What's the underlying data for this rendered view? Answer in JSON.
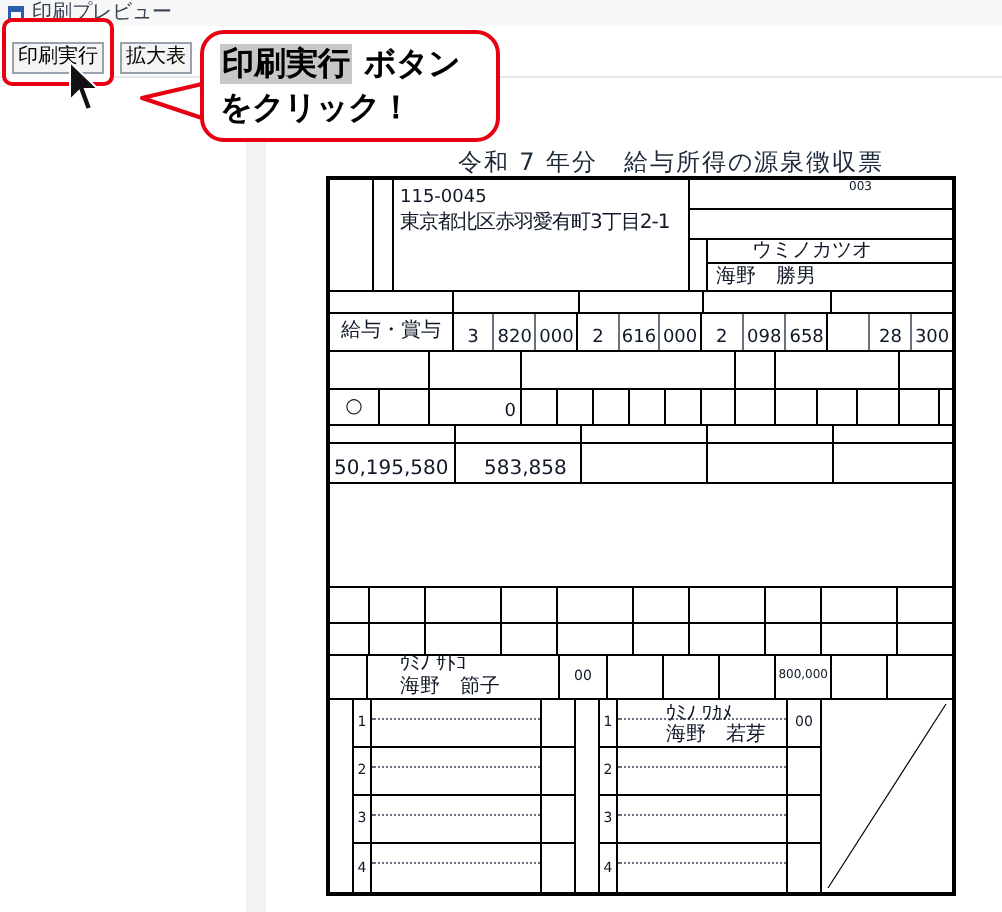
{
  "window": {
    "title": "印刷プレビュー"
  },
  "toolbar": {
    "buttons": [
      {
        "label": "印刷実行",
        "highlighted": true
      },
      {
        "label": "拡大表",
        "highlighted": false
      }
    ]
  },
  "callout": {
    "highlight": "印刷実行",
    "line_1": "ボタン",
    "line_2": "をクリック！"
  },
  "form": {
    "title": "令和 7 年分　給与所得の源泉徴収票",
    "postal_code": "115-0045",
    "address": "東京都北区赤羽愛有町3丁目2-1",
    "recipient_number": "003",
    "name_kana": "ウミノカツオ",
    "name": "海野　勝男",
    "type": "給与・賞与",
    "amounts": [
      [
        "3",
        "820",
        "000"
      ],
      [
        "2",
        "616",
        "000"
      ],
      [
        "2",
        "098",
        "658"
      ],
      [
        "28",
        "300"
      ]
    ],
    "spouse_mark": "○",
    "spouse_deduction": "0",
    "row_amounts": [
      "50,195,580",
      "583,858"
    ],
    "spouse": {
      "kana": "ｳﾐﾉ ｻﾄｺ",
      "name": "海野　節子",
      "code": "00",
      "amount": "800,000"
    },
    "dependents_left": [
      {
        "no": "1"
      },
      {
        "no": "2"
      },
      {
        "no": "3"
      },
      {
        "no": "4"
      }
    ],
    "dependents_right": [
      {
        "no": "1",
        "kana": "ｳﾐﾉ ﾜｶﾒ",
        "name": "海野　若芽",
        "code": "00"
      },
      {
        "no": "2"
      },
      {
        "no": "3"
      },
      {
        "no": "4"
      }
    ]
  }
}
